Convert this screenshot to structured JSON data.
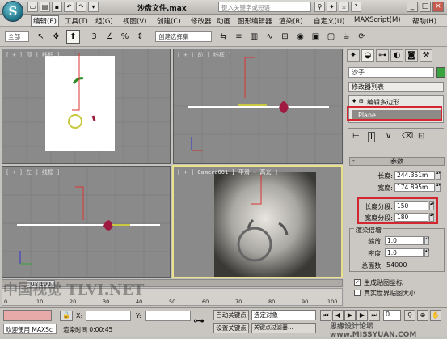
{
  "app": {
    "title": "沙盘文件.max",
    "search_placeholder": "键入关键字或短语",
    "logo": "S"
  },
  "menu": [
    "编辑(E)",
    "工具(T)",
    "组(G)",
    "视图(V)",
    "创建(C)",
    "修改器",
    "动画",
    "图形编辑器",
    "渲染(R)",
    "自定义(U)",
    "MAXScript(M)",
    "帮助(H)"
  ],
  "toolbar": {
    "selection_filter": "全部",
    "named_set": "创建选择集",
    "icon_a": "↶",
    "icon_b": "↷",
    "tool_c": "▣",
    "tool_d": "3",
    "tool_e": "%",
    "tool_f": "n"
  },
  "viewports": {
    "top": "[ + ] 顶 ] 线框 ]",
    "front": "[ + ] 前 ] 线框 ]",
    "left": "[ + ] 左 ] 线框 ]",
    "camera": "[ + ] Camera001 ] 平滑 + 高光 ]"
  },
  "cmd": {
    "object_name": "沙子",
    "modifier_list": "修改器列表",
    "stack": [
      "编辑多边形",
      "Plane"
    ],
    "rollout": "参数",
    "length_label": "长度:",
    "length": "244.351m",
    "width_label": "宽度:",
    "width": "174.895m",
    "lsegs_label": "长度分段:",
    "lsegs": "150",
    "wsegs_label": "宽度分段:",
    "wsegs": "180",
    "render_mult": "渲染倍增",
    "scale_label": "缩放:",
    "scale": "1.0",
    "density_label": "密度:",
    "density": "1.0",
    "faces_label": "总面数:",
    "faces": "54000",
    "gen_map": "生成贴图坐标",
    "real_world": "真实世界贴图大小"
  },
  "bottom": {
    "frame": "0 / 100",
    "ticks": [
      "0",
      "10",
      "20",
      "30",
      "40",
      "50",
      "60",
      "70",
      "80",
      "90",
      "100"
    ],
    "status": "欢迎使用 MAXSc",
    "render_time": "渲染时间 0:00:45",
    "x_label": "X:",
    "y_label": "Y:",
    "auto_key": "自动关键点",
    "set_key": "设置关键点",
    "selected": "选定对象",
    "key_filter": "关键点过滤器...",
    "frame_no": "0"
  },
  "watermark": {
    "left": "中国视觉  TLVI.NET",
    "right": "思缘设计论坛  www.MISSYUAN.COM"
  }
}
